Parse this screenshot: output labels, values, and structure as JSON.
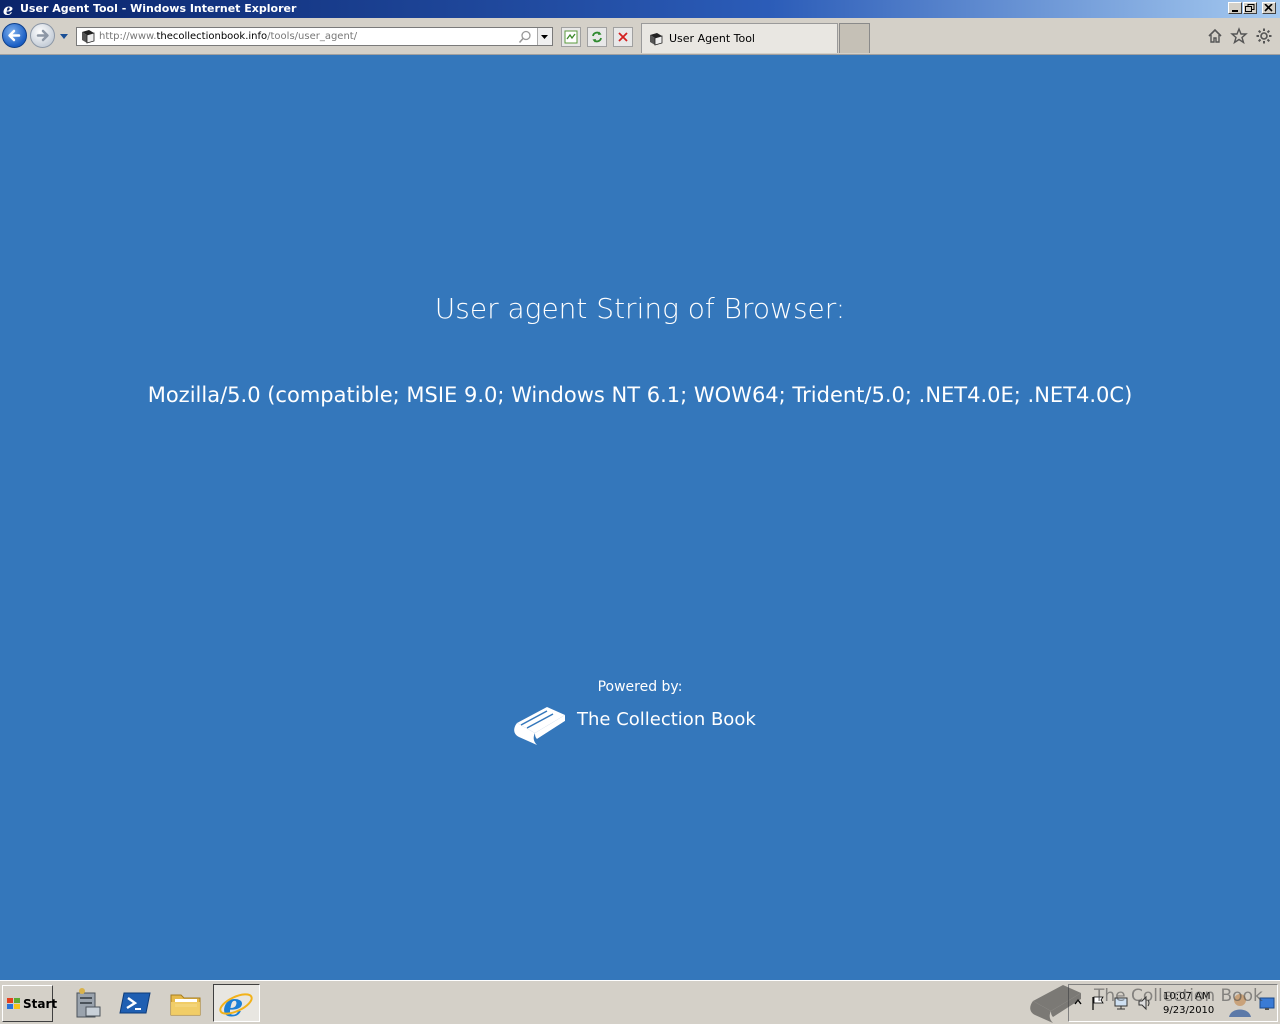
{
  "window": {
    "title": "User Agent Tool - Windows Internet Explorer"
  },
  "address_bar": {
    "url_prefix": "http://www.",
    "url_domain": "thecollectionbook.info",
    "url_path": "/tools/user_agent/"
  },
  "tabs": [
    {
      "label": "User Agent Tool",
      "icon": "book-favicon-icon",
      "active": true
    }
  ],
  "page": {
    "heading": "User agent String of Browser:",
    "user_agent": "Mozilla/5.0 (compatible; MSIE 9.0; Windows NT 6.1; WOW64; Trident/5.0; .NET4.0E; .NET4.0C)",
    "powered_by_label": "Powered by:",
    "brand_name": "The Collection Book",
    "background_color": "#3477bb"
  },
  "taskbar": {
    "start_label": "Start",
    "pinned": [
      "server-manager-icon",
      "powershell-icon",
      "explorer-folder-icon",
      "internet-explorer-icon"
    ],
    "tray_icons": [
      "show-hidden-icons-chevron",
      "action-center-flag-icon",
      "network-icon",
      "volume-icon"
    ],
    "time": "10:07 AM",
    "date": "9/23/2010"
  },
  "watermark": {
    "text": "The Collection Book"
  }
}
